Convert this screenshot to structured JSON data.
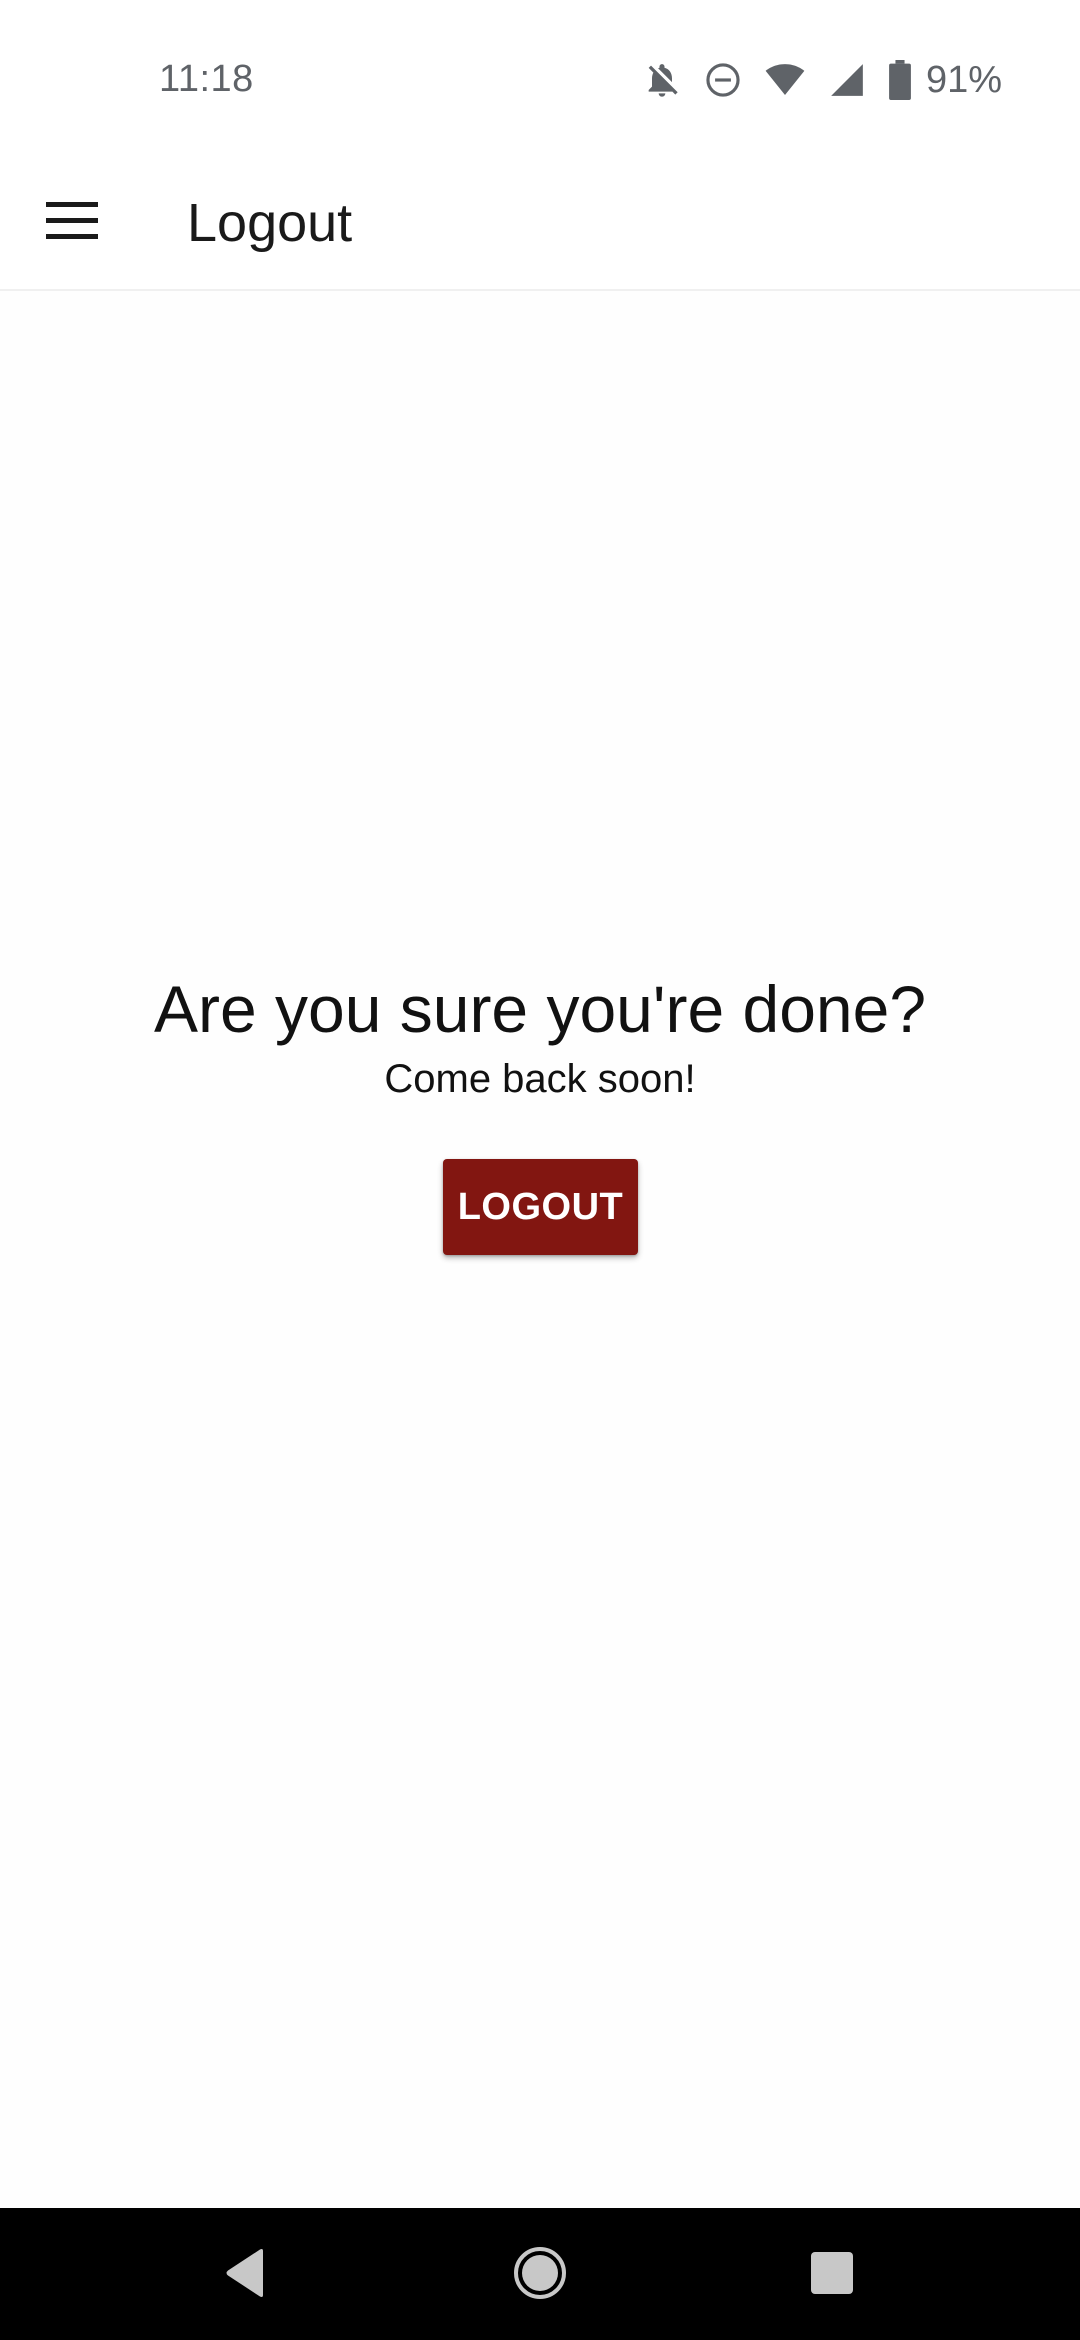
{
  "status_bar": {
    "time": "11:18",
    "battery_percent": "91%",
    "icons": [
      "notifications-off-icon",
      "do-not-disturb-icon",
      "wifi-icon",
      "cell-signal-icon",
      "battery-icon"
    ]
  },
  "app_bar": {
    "title": "Logout",
    "menu_icon": "hamburger-menu-icon"
  },
  "main": {
    "headline": "Are you sure you're done?",
    "subline": "Come back soon!",
    "logout_button_label": "LOGOUT"
  },
  "nav_bar": {
    "icons": [
      "back-icon",
      "home-icon",
      "recents-icon"
    ]
  },
  "colors": {
    "accent": "#821611",
    "background": "#fefefe",
    "nav_bar": "#000000"
  }
}
